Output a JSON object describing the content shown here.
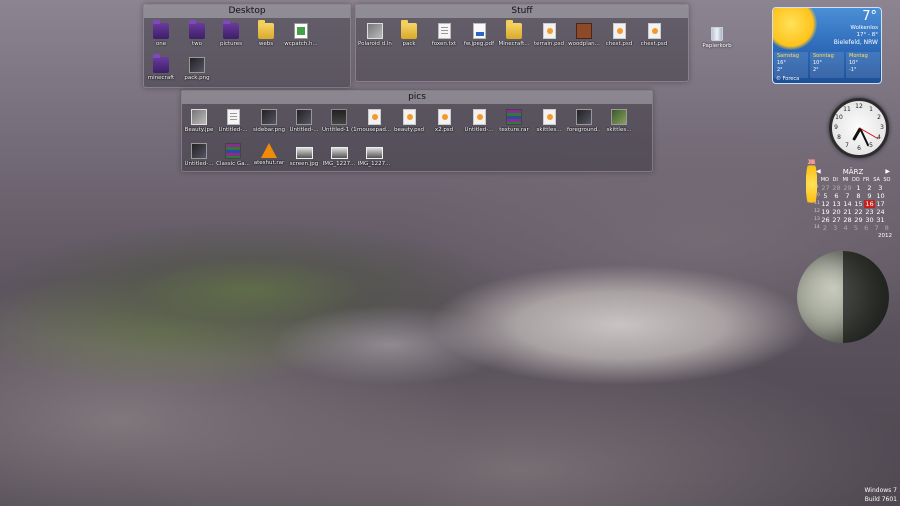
{
  "desktop_fence": {
    "title": "Desktop",
    "items": [
      {
        "label": "one",
        "icon": "folder-purple"
      },
      {
        "label": "two",
        "icon": "folder-purple"
      },
      {
        "label": "pictures",
        "icon": "folder-purple"
      },
      {
        "label": "webs",
        "icon": "folder-yellow"
      },
      {
        "label": "wcpatch.h...",
        "icon": "html"
      },
      {
        "label": "minecraft",
        "icon": "folder-purple"
      },
      {
        "label": "pack.png",
        "icon": "image-dark"
      }
    ]
  },
  "stuff_fence": {
    "title": "Stuff",
    "items": [
      {
        "label": "Polaroid d.lnk",
        "icon": "shortcut"
      },
      {
        "label": "pack",
        "icon": "folder-yellow"
      },
      {
        "label": "foxen.txt",
        "icon": "doc"
      },
      {
        "label": "fw.jpeg.pdf",
        "icon": "pdf"
      },
      {
        "label": "Minecraft...",
        "icon": "folder-yellow"
      },
      {
        "label": "terrain.psd",
        "icon": "psd"
      },
      {
        "label": "woodplan...",
        "icon": "winrar"
      },
      {
        "label": "chest.psd",
        "icon": "psd"
      },
      {
        "label": "chest.psd",
        "icon": "psd"
      }
    ]
  },
  "pics_fence": {
    "title": "pics",
    "items": [
      {
        "label": "Beauty.jpe",
        "icon": "image"
      },
      {
        "label": "Untitled-...",
        "icon": "doc"
      },
      {
        "label": "sidebar.png",
        "icon": "image-dark"
      },
      {
        "label": "Untitled-...",
        "icon": "image-dark"
      },
      {
        "label": "Untitled-1 (1).png",
        "icon": "game"
      },
      {
        "label": "mousepad...",
        "icon": "psd"
      },
      {
        "label": "beauty.psd",
        "icon": "psd"
      },
      {
        "label": "x2.psd",
        "icon": "psd"
      },
      {
        "label": "Untitled-...",
        "icon": "psd"
      },
      {
        "label": "texture.rar",
        "icon": "rar"
      },
      {
        "label": "skittles...",
        "icon": "psd"
      },
      {
        "label": "foreground...",
        "icon": "image-dark"
      },
      {
        "label": "skittles...",
        "icon": "image-green"
      },
      {
        "label": "Untitled-...",
        "icon": "image-dark"
      },
      {
        "label": "Classic Ga...",
        "icon": "rar"
      },
      {
        "label": "ateshut.rar",
        "icon": "vlc"
      },
      {
        "label": "screen.jpg",
        "icon": "image-wide"
      },
      {
        "label": "IMG_1227...",
        "icon": "image-wide"
      },
      {
        "label": "IMG_1227...",
        "icon": "image-wide"
      }
    ]
  },
  "recycle_bin": {
    "label": "Papierkorb"
  },
  "weather": {
    "temp": "7°",
    "condition": "Wolkenlos",
    "range": "17° - 8°",
    "city": "Bielefeld, NRW",
    "days": [
      {
        "name": "Samstag",
        "hi": "16°",
        "lo": "2°"
      },
      {
        "name": "Sonntag",
        "hi": "10°",
        "lo": "2°"
      },
      {
        "name": "Montag",
        "hi": "10°",
        "lo": "-1°"
      }
    ],
    "brand": "© Foreca"
  },
  "clock": {
    "numbers": [
      "12",
      "1",
      "2",
      "3",
      "4",
      "5",
      "6",
      "7",
      "8",
      "9",
      "10",
      "11"
    ]
  },
  "calendar": {
    "month": "MÄRZ",
    "year": "2012",
    "weekdays": [
      "MO",
      "DI",
      "MI",
      "DO",
      "FR",
      "SA",
      "SO"
    ],
    "rows": [
      {
        "wk": "9",
        "days": [
          "27",
          "28",
          "29",
          "1",
          "2",
          "3",
          "4"
        ]
      },
      {
        "wk": "10",
        "days": [
          "5",
          "6",
          "7",
          "8",
          "9",
          "10",
          "11"
        ]
      },
      {
        "wk": "11",
        "days": [
          "12",
          "13",
          "14",
          "15",
          "16",
          "17",
          "18"
        ]
      },
      {
        "wk": "12",
        "days": [
          "19",
          "20",
          "21",
          "22",
          "23",
          "24",
          "25"
        ]
      },
      {
        "wk": "13",
        "days": [
          "26",
          "27",
          "28",
          "29",
          "30",
          "31",
          "1"
        ]
      },
      {
        "wk": "14",
        "days": [
          "2",
          "3",
          "4",
          "5",
          "6",
          "7",
          "8"
        ]
      }
    ],
    "prev_arrow": "◀",
    "next_arrow": "▶"
  },
  "watermark": {
    "line1": "Windows 7",
    "line2": "Build 7601"
  }
}
